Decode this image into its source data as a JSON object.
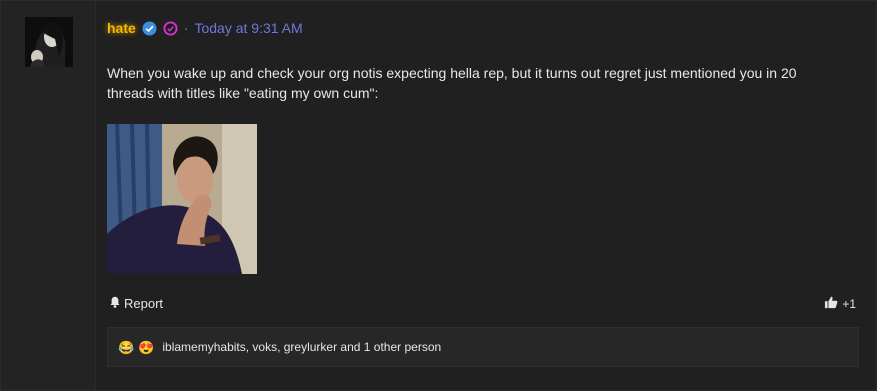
{
  "post": {
    "username": "hate",
    "timestamp_prefix": "·",
    "timestamp": "Today at 9:31 AM",
    "message": "When you wake up and check your org notis expecting hella rep, but it turns out regret just mentioned you in 20 threads with titles like \"eating my own cum\":",
    "report_label": "Report",
    "plus_count": "+1"
  },
  "reactions": {
    "emojis": [
      "😂",
      "😍"
    ],
    "names_text": "iblamemyhabits, voks, greylurker and 1 other person"
  },
  "colors": {
    "username": "#f5b800",
    "timestamp": "#6e78d8",
    "verified_badge": "#3c8de0",
    "secondary_badge": "#d62fd6",
    "background": "#202020"
  },
  "icons": {
    "verified": "check-badge-icon",
    "secondary": "pink-check-badge-icon",
    "report": "bell-icon",
    "plus": "thumbs-up-icon"
  }
}
